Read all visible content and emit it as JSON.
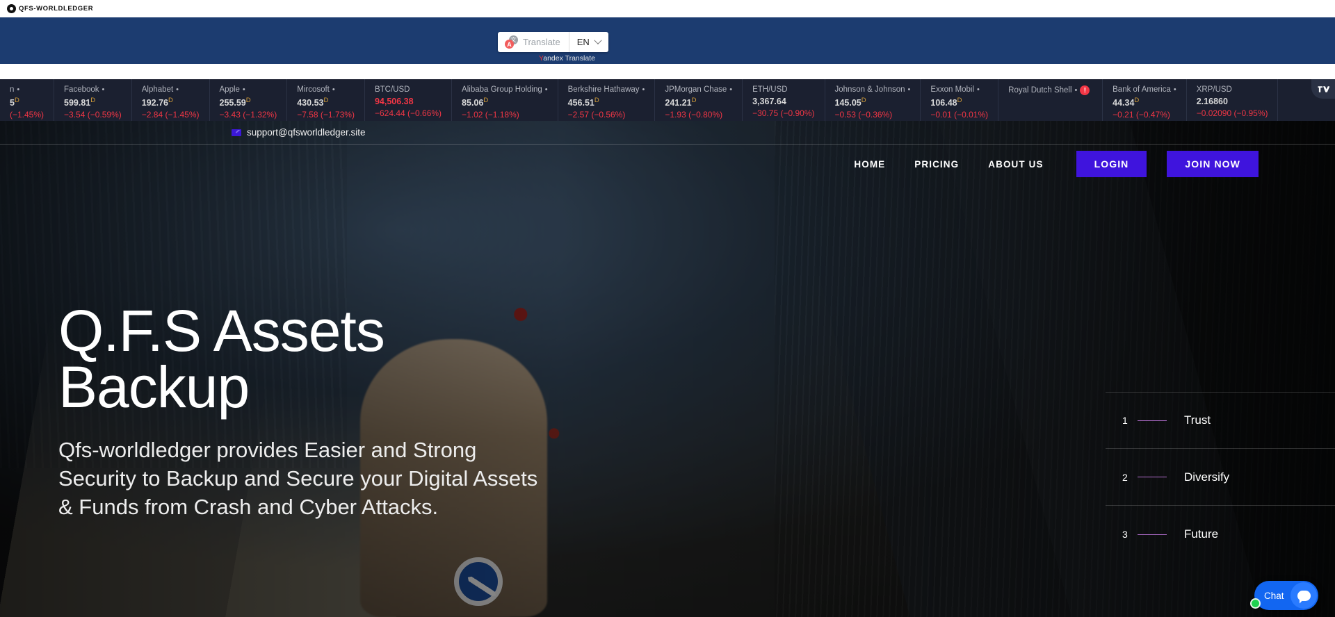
{
  "brand": {
    "name": "QFS-WORLDLEDGER"
  },
  "translate": {
    "label": "Translate",
    "language": "EN",
    "credit_y": "Y",
    "credit_rest": "andex Translate"
  },
  "ticker": {
    "items": [
      {
        "name": "n",
        "price": "5",
        "suffix": "D",
        "change": "(−1.45%)",
        "partial": true,
        "red": false
      },
      {
        "name": "Facebook",
        "price": "599.81",
        "suffix": "D",
        "change": "−3.54 (−0.59%)",
        "red": false
      },
      {
        "name": "Alphabet",
        "price": "192.76",
        "suffix": "D",
        "change": "−2.84 (−1.45%)",
        "red": false
      },
      {
        "name": "Apple",
        "price": "255.59",
        "suffix": "D",
        "change": "−3.43 (−1.32%)",
        "red": false
      },
      {
        "name": "Mircosoft",
        "price": "430.53",
        "suffix": "D",
        "change": "−7.58 (−1.73%)",
        "red": false
      },
      {
        "name": "BTC/USD",
        "price": "94,506.38",
        "suffix": "",
        "change": "−624.44 (−0.66%)",
        "red": true,
        "nodot": true
      },
      {
        "name": "Alibaba Group Holding",
        "price": "85.06",
        "suffix": "D",
        "change": "−1.02 (−1.18%)",
        "red": false
      },
      {
        "name": "Berkshire Hathaway",
        "price": "456.51",
        "suffix": "D",
        "change": "−2.57 (−0.56%)",
        "red": false
      },
      {
        "name": "JPMorgan Chase",
        "price": "241.21",
        "suffix": "D",
        "change": "−1.93 (−0.80%)",
        "red": false
      },
      {
        "name": "ETH/USD",
        "price": "3,367.64",
        "suffix": "",
        "change": "−30.75 (−0.90%)",
        "red": false,
        "nodot": true
      },
      {
        "name": "Johnson & Johnson",
        "price": "145.05",
        "suffix": "D",
        "change": "−0.53 (−0.36%)",
        "red": false
      },
      {
        "name": "Exxon Mobil",
        "price": "106.48",
        "suffix": "D",
        "change": "−0.01 (−0.01%)",
        "red": false
      },
      {
        "name": "Royal Dutch Shell",
        "price": "",
        "suffix": "",
        "change": "",
        "error": true
      },
      {
        "name": "Bank of America",
        "price": "44.34",
        "suffix": "D",
        "change": "−0.21 (−0.47%)",
        "red": false
      },
      {
        "name": "XRP/USD",
        "price": "2.16860",
        "suffix": "",
        "change": "−0.02090 (−0.95%)",
        "red": false,
        "nodot": true
      }
    ],
    "attribution": "tradingview-logo"
  },
  "topbar": {
    "email": "support@qfsworldledger.site"
  },
  "nav": {
    "links": [
      {
        "label": "HOME"
      },
      {
        "label": "PRICING"
      },
      {
        "label": "ABOUT US"
      }
    ],
    "login_label": "LOGIN",
    "join_label": "JOIN NOW",
    "accent_color": "#3f14dd"
  },
  "hero": {
    "heading_line1": "Q.F.S Assets",
    "heading_line2": "Backup",
    "paragraph": "Qfs-worldledger provides Easier and Strong Security to Backup and Secure your Digital Assets & Funds from Crash and Cyber Attacks."
  },
  "slides": [
    {
      "num": "1",
      "label": "Trust"
    },
    {
      "num": "2",
      "label": "Diversify"
    },
    {
      "num": "3",
      "label": "Future"
    }
  ],
  "chat": {
    "label": "Chat"
  }
}
